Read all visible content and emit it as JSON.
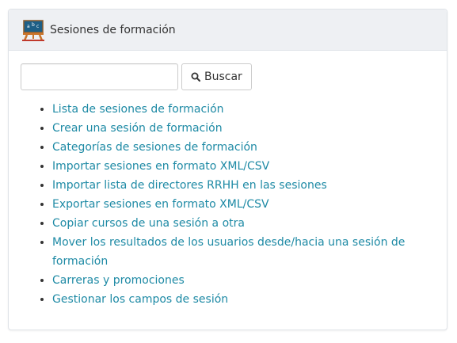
{
  "panel": {
    "title": "Sesiones de formación",
    "icon": "blackboard-abc-icon"
  },
  "search": {
    "value": "",
    "placeholder": "",
    "button_label": "Buscar",
    "button_icon": "search-icon"
  },
  "menu": {
    "items": [
      {
        "label": "Lista de sesiones de formación"
      },
      {
        "label": "Crear una sesión de formación"
      },
      {
        "label": "Categorías de sesiones de formación"
      },
      {
        "label": "Importar sesiones en formato XML/CSV"
      },
      {
        "label": "Importar lista de directores RRHH en las sesiones"
      },
      {
        "label": "Exportar sesiones en formato XML/CSV"
      },
      {
        "label": "Copiar cursos de una sesión a otra"
      },
      {
        "label": "Mover los resultados de los usuarios desde/hacia una sesión de formación"
      },
      {
        "label": "Carreras y promociones"
      },
      {
        "label": "Gestionar los campos de sesión"
      }
    ]
  },
  "colors": {
    "link": "#1e8aa5",
    "header_bg": "#eef0f3",
    "border": "#dfe3e8"
  }
}
